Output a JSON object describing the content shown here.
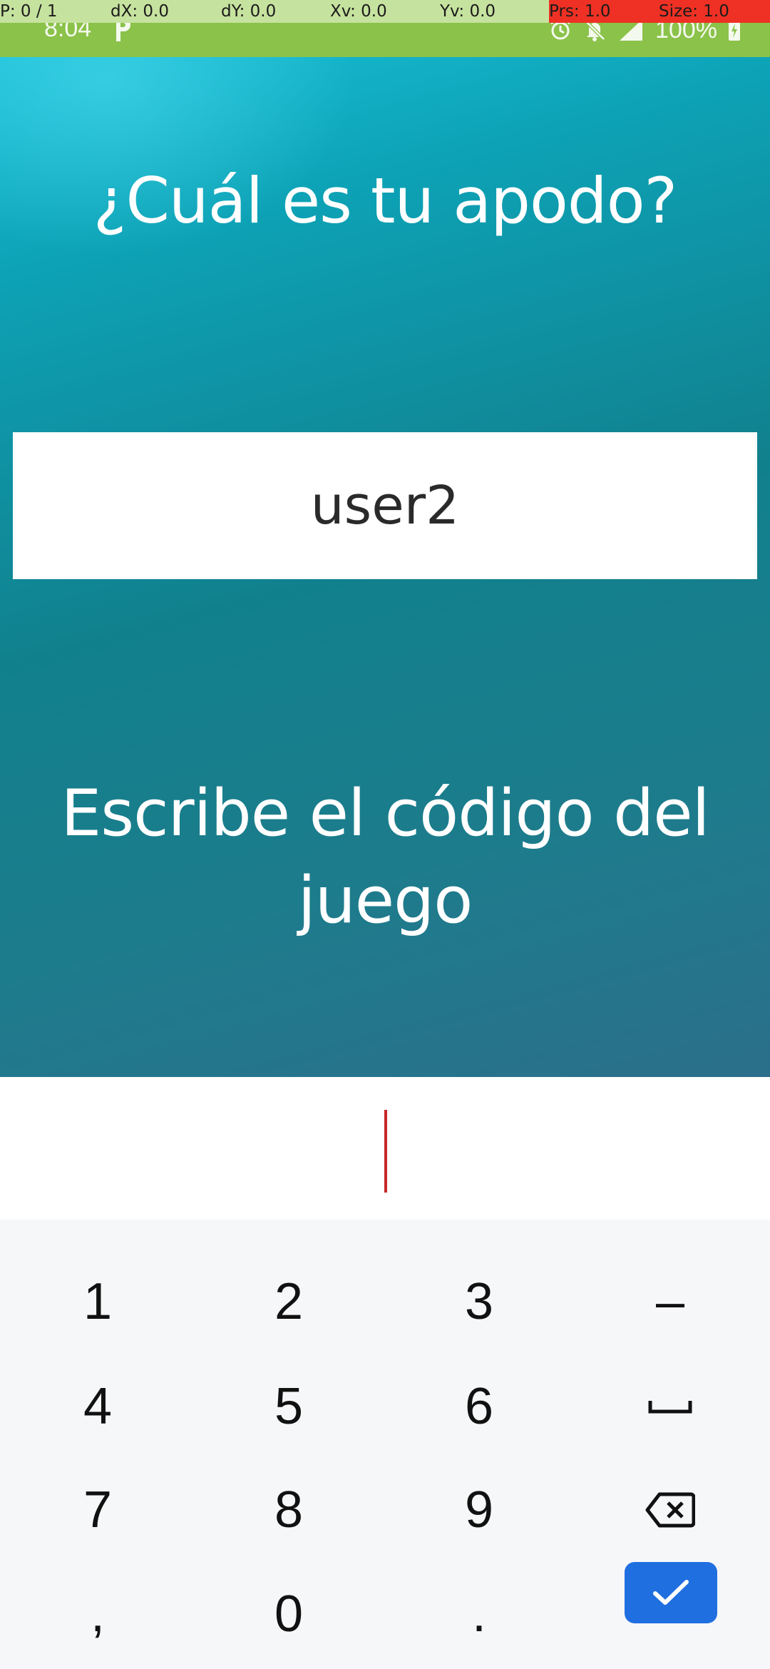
{
  "pointer_bar": {
    "pointer": "P: 0 / 1",
    "dx": "dX: 0.0",
    "dy": "dY: 0.0",
    "xv": "Xv: 0.0",
    "yv": "Yv: 0.0",
    "prs": "Prs: 1.0",
    "size": "Size: 1.0",
    "alert_color": "#ee3124"
  },
  "status_bar": {
    "time": "8:04",
    "notification_icon": "p-icon",
    "icons": [
      "alarm-icon",
      "bell-off-icon",
      "signal-icon",
      "battery-charging-icon"
    ],
    "battery": "100%"
  },
  "main": {
    "question": "¿Cuál es tu apodo?",
    "nickname_value": "user2",
    "code_prompt": "Escribe el código del juego"
  },
  "code_input": {
    "value": "",
    "caret_color": "#c62828"
  },
  "keyboard": {
    "rows": [
      [
        "1",
        "2",
        "3",
        "–"
      ],
      [
        "4",
        "5",
        "6",
        "space-icon"
      ],
      [
        "7",
        "8",
        "9",
        "backspace-icon"
      ],
      [
        ",",
        "0",
        ".",
        "check-icon"
      ]
    ],
    "key_1": "1",
    "key_2": "2",
    "key_3": "3",
    "key_dash": "–",
    "key_4": "4",
    "key_5": "5",
    "key_6": "6",
    "key_7": "7",
    "key_8": "8",
    "key_9": "9",
    "key_comma": ",",
    "key_0": "0",
    "key_period": ".",
    "confirm_color": "#1f6fe0"
  },
  "colors": {
    "status_bar": "#8bc24a",
    "overlay": "#c6e29f",
    "teal_top": "#19bfd6",
    "teal_bottom": "#2b6f8b"
  }
}
